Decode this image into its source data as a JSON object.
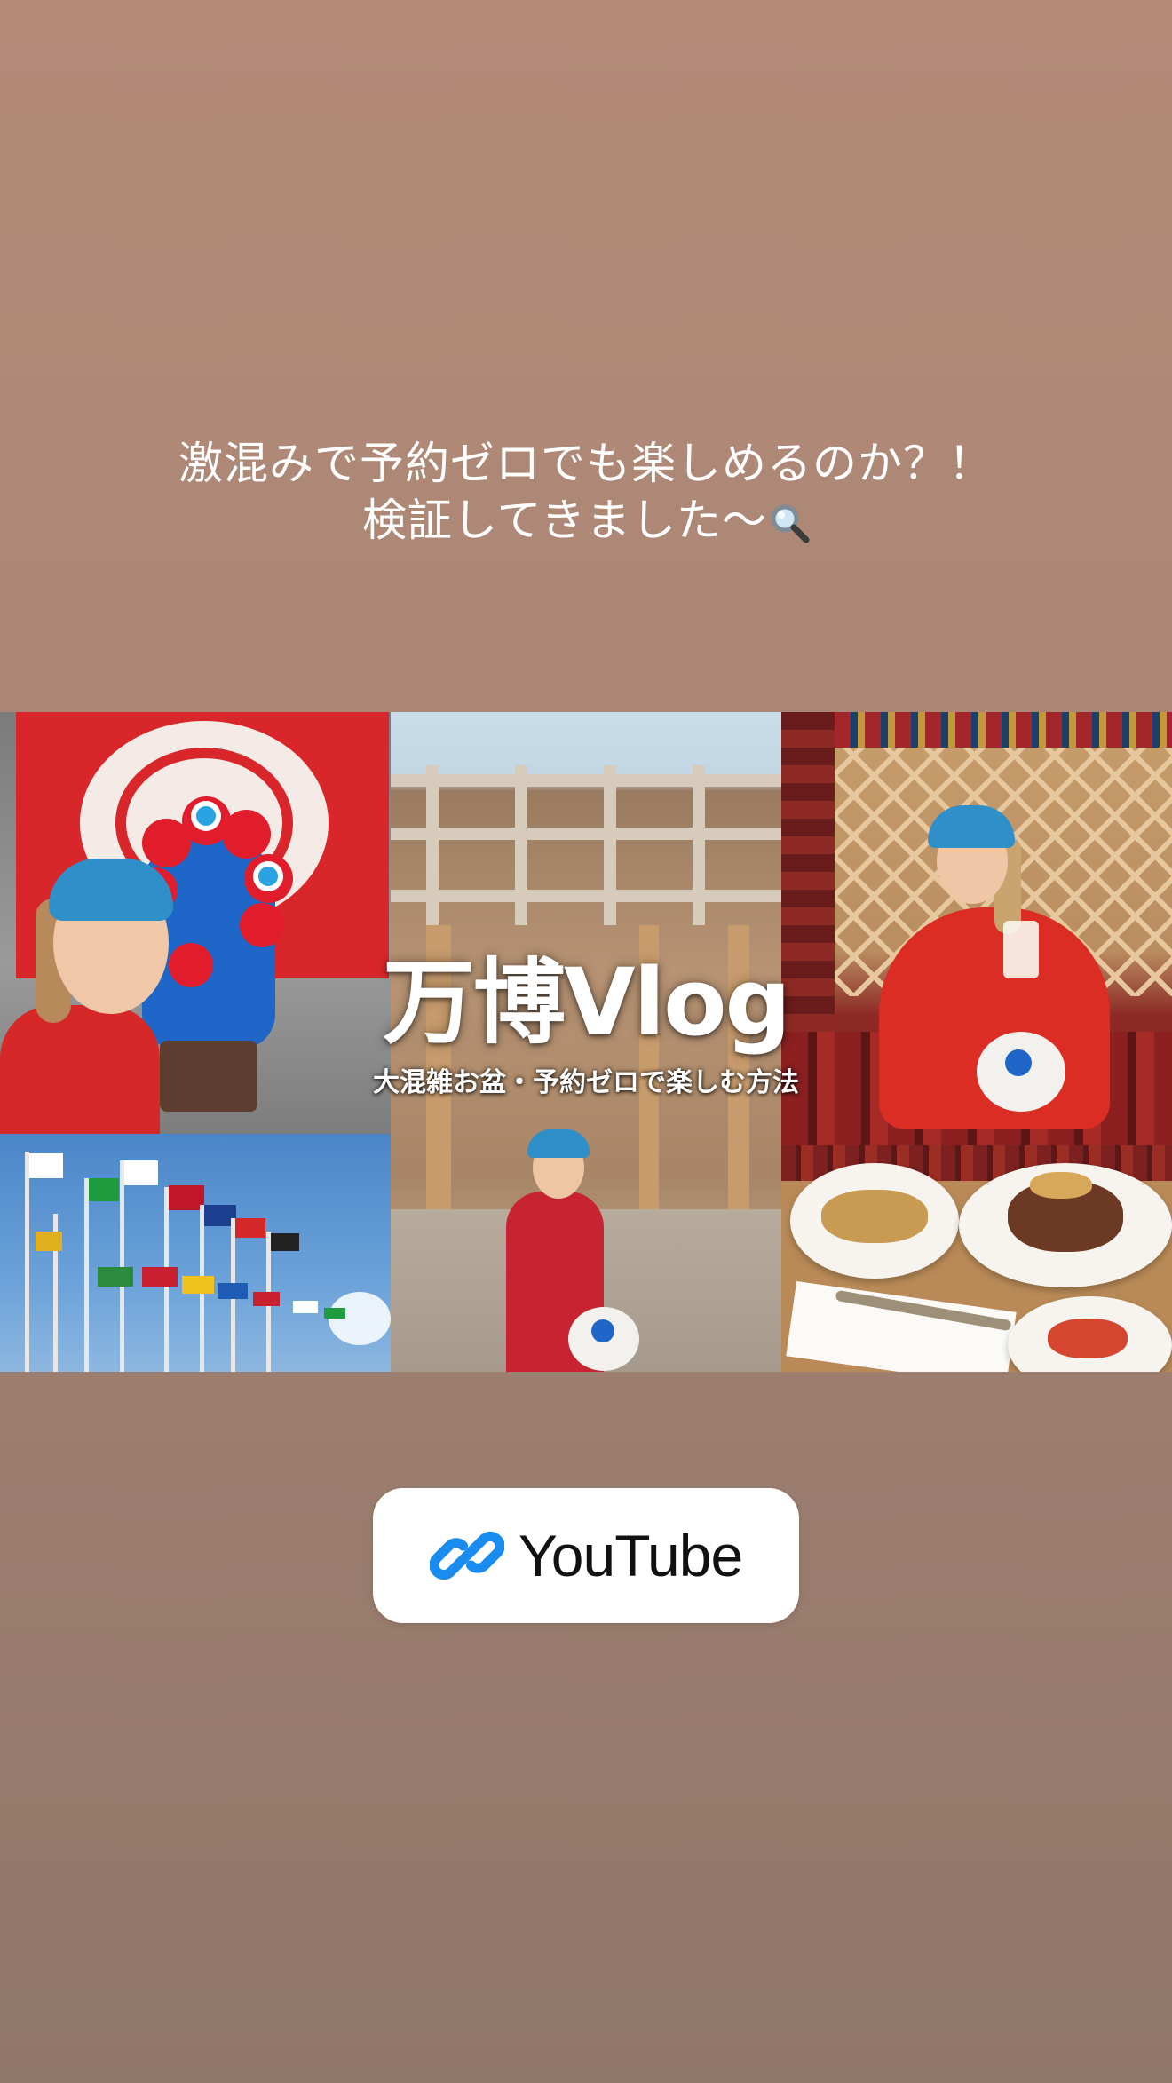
{
  "story": {
    "caption_line1": "激混みで予約ゼロでも楽しめるのか？！",
    "caption_line2": "検証してきました〜",
    "caption_emoji": "magnifier-icon"
  },
  "thumbnail": {
    "title": "万博Vlog",
    "subtitle": "大混雑お盆・予約ゼロで楽しむ方法"
  },
  "link_sticker": {
    "label": "YouTube",
    "icon": "link-icon"
  },
  "colors": {
    "background_top": "#b48b79",
    "background_bottom": "#917768",
    "link_icon_blue": "#1a8cf0",
    "sticker_bg": "#ffffff"
  }
}
